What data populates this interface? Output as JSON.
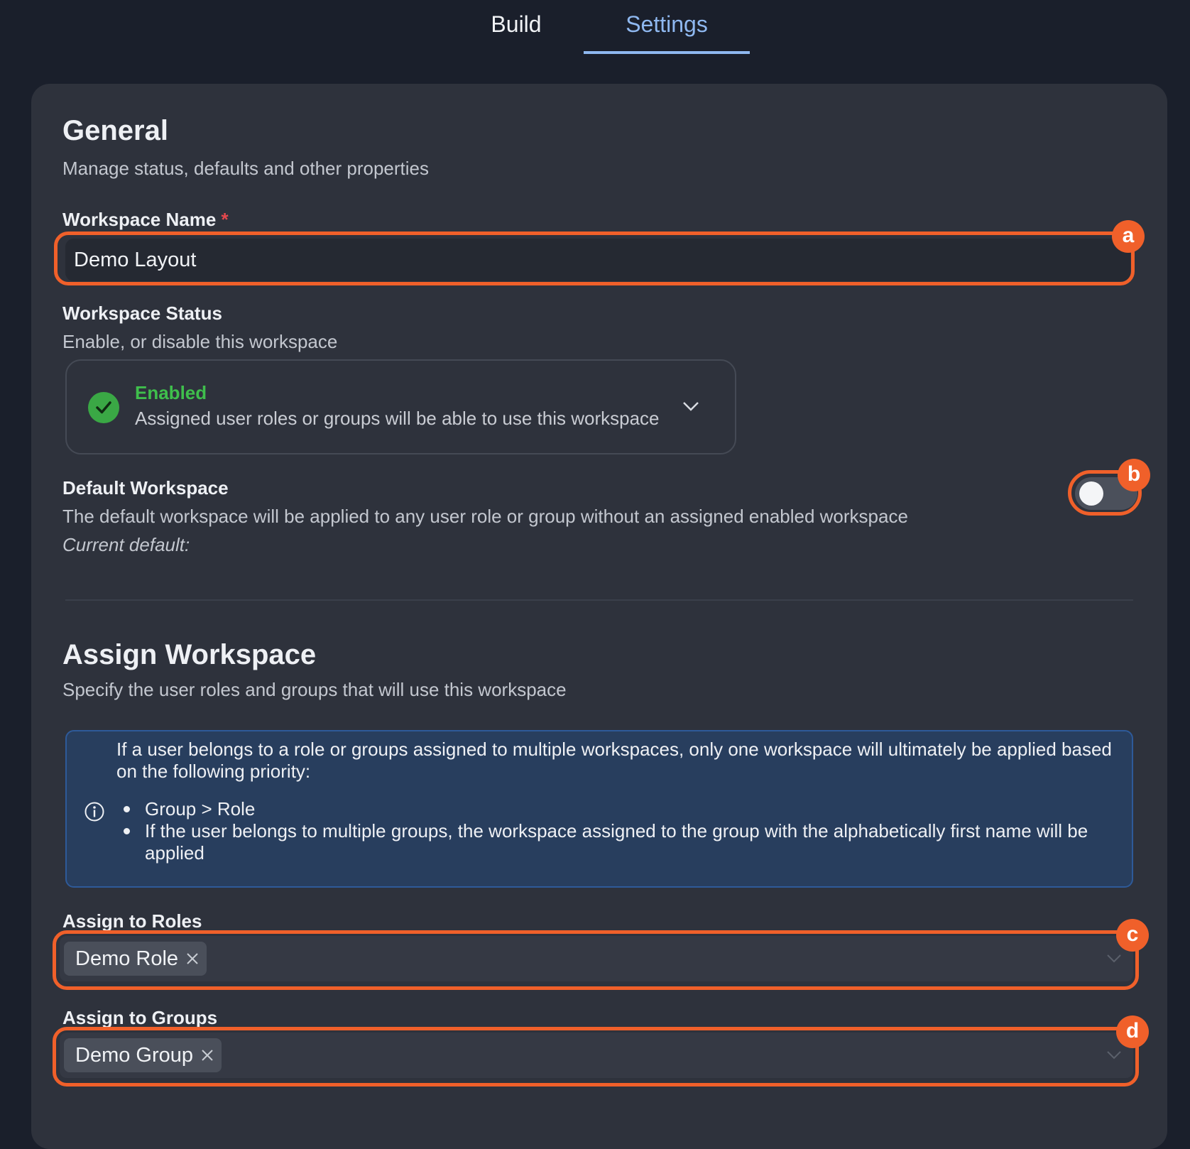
{
  "tabs": {
    "build": "Build",
    "settings": "Settings",
    "active": "settings"
  },
  "general": {
    "title": "General",
    "subtitle": "Manage status, defaults and other properties",
    "workspace_name_label": "Workspace Name",
    "required_marker": "*",
    "workspace_name_value": "Demo Layout",
    "status_label": "Workspace Status",
    "status_desc": "Enable, or disable this workspace",
    "status_value": "Enabled",
    "status_value_desc": "Assigned user roles or groups will be able to use this workspace",
    "default_label": "Default Workspace",
    "default_desc": "The default workspace will be applied to any user role or group without an assigned enabled workspace",
    "current_default": "Current default:",
    "default_toggle_on": false
  },
  "assign": {
    "title": "Assign Workspace",
    "subtitle": "Specify the user roles and groups that will use this workspace",
    "info_intro": "If a user belongs to a role or groups assigned to multiple workspaces, only one workspace will ultimately be applied based on the following priority:",
    "info_items": [
      "Group > Role",
      "If the user belongs to multiple groups, the workspace assigned to the group with the alphabetically first name will be applied"
    ],
    "roles_label": "Assign to Roles",
    "roles_selected": [
      "Demo Role"
    ],
    "groups_label": "Assign to Groups",
    "groups_selected": [
      "Demo Group"
    ]
  },
  "annotations": [
    "a",
    "b",
    "c",
    "d"
  ],
  "colors": {
    "accent_tab": "#8fb8f0",
    "highlight": "#f0602a",
    "enabled_green": "#3fbf4c",
    "info_bg": "#283e5e"
  }
}
